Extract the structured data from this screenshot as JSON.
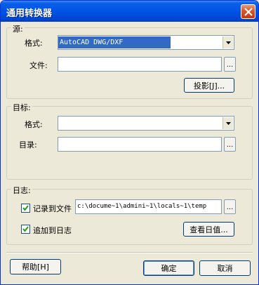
{
  "window": {
    "title": "通用转换器"
  },
  "source": {
    "label": "源:",
    "format_label": "格式:",
    "format_value": "AutoCAD DWG/DXF",
    "file_label": "文件:",
    "file_value": "",
    "browse_label": "...",
    "project_button": "投影[J]..."
  },
  "target": {
    "label": "目标:",
    "format_label": "格式:",
    "format_value": "",
    "dir_label": "目录:",
    "dir_value": "",
    "browse_label": "..."
  },
  "log": {
    "label": "日志:",
    "record_label": "记录到文件",
    "record_checked": true,
    "record_path": "c:\\docume~1\\admini~1\\locals~1\\temp",
    "browse_label": "...",
    "append_label": "追加到日志",
    "append_checked": true,
    "view_log_button": "查看日值..."
  },
  "footer": {
    "help_button": "帮助[H]",
    "ok_button": "确定",
    "cancel_button": "取消"
  },
  "icons": {
    "close": "close-icon",
    "dropdown": "chevron-down-icon",
    "check": "check-icon"
  },
  "colors": {
    "titlebar": "#0055e5",
    "selection": "#316ac5",
    "dialog_bg": "#ece9d8"
  }
}
